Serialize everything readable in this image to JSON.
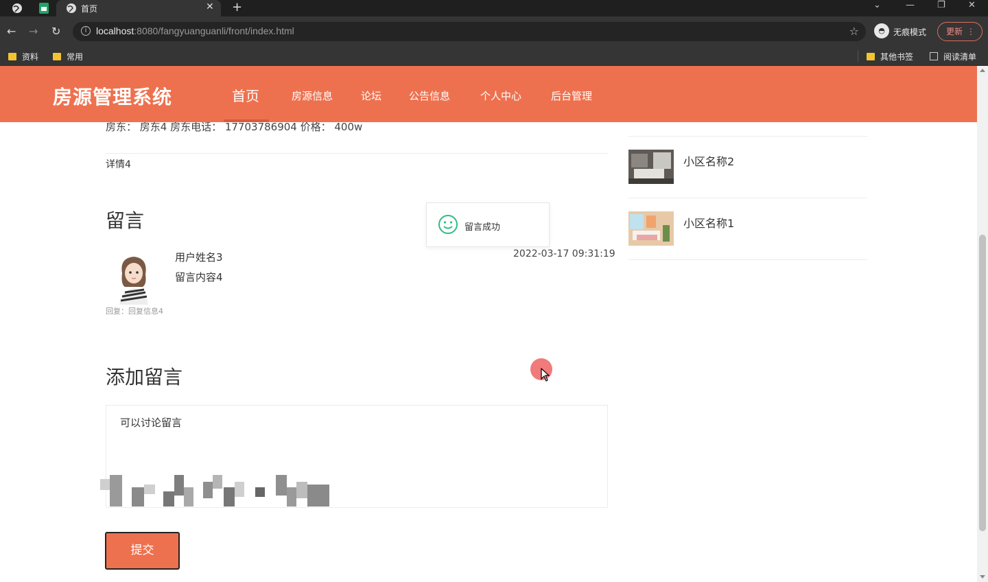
{
  "browser": {
    "tab_title": "首页",
    "url_host": "localhost",
    "url_path": ":8080/fangyuanguanli/front/index.html",
    "incognito_label": "无痕模式",
    "update_label": "更新",
    "bookmarks": [
      "资料",
      "常用"
    ],
    "bookmarks_right": [
      "其他书签",
      "阅读清单"
    ]
  },
  "header": {
    "site_title": "房源管理系统",
    "nav": [
      "首页",
      "房源信息",
      "论坛",
      "公告信息",
      "个人中心",
      "后台管理"
    ],
    "active_index": 0,
    "brand_color": "#ee714f"
  },
  "listing": {
    "info_line": "房东：  房东4    房东电话：  17703786904    价格：  400w",
    "detail": "详情4"
  },
  "comments": {
    "heading": "留言",
    "items": [
      {
        "user": "用户姓名3",
        "content": "留言内容4",
        "time": "2022-03-17 09:31:19",
        "reply": "回复：回复信息4"
      }
    ]
  },
  "toast": {
    "text": "留言成功"
  },
  "add_comment": {
    "heading": "添加留言",
    "textarea_value": "可以讨论留言",
    "submit_label": "提交"
  },
  "sidebar": {
    "items": [
      {
        "name": "小区名称2"
      },
      {
        "name": "小区名称1"
      }
    ]
  }
}
